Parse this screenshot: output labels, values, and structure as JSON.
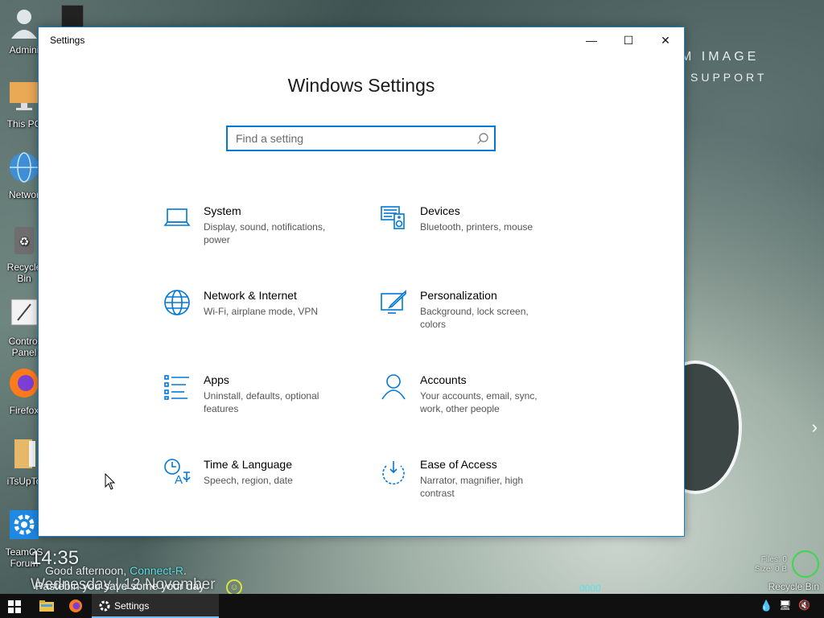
{
  "desktop": {
    "icons": [
      {
        "label": "Admini",
        "icon": "user-icon"
      },
      {
        "label": "This PC",
        "icon": "computer-icon"
      },
      {
        "label": "Networ",
        "icon": "network-globe-icon"
      },
      {
        "label": "Recycle Bin",
        "icon": "recycle-bin-icon"
      },
      {
        "label": "Control Panel",
        "icon": "control-panel-icon"
      },
      {
        "label": "Firefox",
        "icon": "firefox-icon"
      },
      {
        "label": "iTsUpTo",
        "icon": "folder-icon"
      },
      {
        "label": "TeamOS Forum",
        "icon": "gear-shortcut-icon"
      }
    ],
    "wallpaper_text_1": "M IMAGE",
    "wallpaper_text_2": "SUPPORT",
    "clock": "14:35",
    "greeting_prefix": "Good afternoon,",
    "greeting_name": "Connect-R",
    "greeting_suffix": ".",
    "date": "Wednesday | 12 November",
    "pastebin": "Pastebin you save some your day",
    "smile_glyph": "☺",
    "disk_gauge": "0000",
    "recycle_widget": {
      "files": "Files: 0",
      "size": "Size: 0 B",
      "title": "Recycle Bin"
    },
    "next_arrow": "›"
  },
  "window": {
    "title": "Settings",
    "minimize_glyph": "—",
    "maximize_glyph": "☐",
    "close_glyph": "✕",
    "heading": "Windows Settings",
    "search_placeholder": "Find a setting",
    "tiles": [
      {
        "name": "System",
        "desc": "Display, sound, notifications, power",
        "icon": "laptop-icon"
      },
      {
        "name": "Devices",
        "desc": "Bluetooth, printers, mouse",
        "icon": "devices-icon"
      },
      {
        "name": "Network & Internet",
        "desc": "Wi-Fi, airplane mode, VPN",
        "icon": "globe-icon"
      },
      {
        "name": "Personalization",
        "desc": "Background, lock screen, colors",
        "icon": "personalization-icon"
      },
      {
        "name": "Apps",
        "desc": "Uninstall, defaults, optional features",
        "icon": "apps-list-icon"
      },
      {
        "name": "Accounts",
        "desc": "Your accounts, email, sync, work, other people",
        "icon": "person-icon"
      },
      {
        "name": "Time & Language",
        "desc": "Speech, region, date",
        "icon": "time-language-icon"
      },
      {
        "name": "Ease of Access",
        "desc": "Narrator, magnifier, high contrast",
        "icon": "ease-of-access-icon"
      }
    ]
  },
  "taskbar": {
    "settings_label": "Settings"
  },
  "colors": {
    "accent": "#0078d7",
    "taskbar": "#101010"
  }
}
